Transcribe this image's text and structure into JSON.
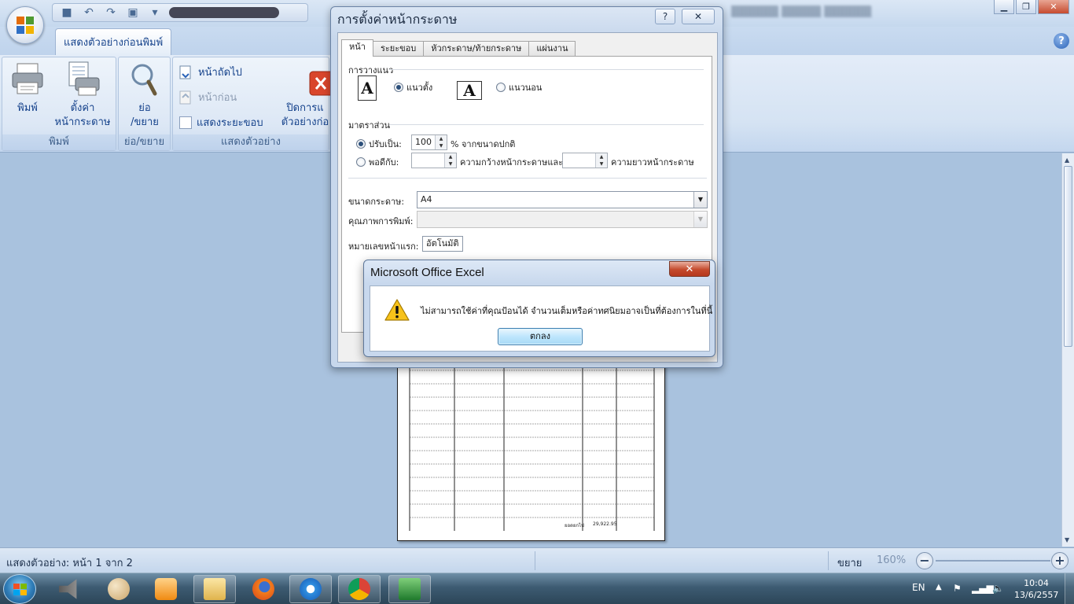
{
  "ribbon": {
    "tab_label": "แสดงตัวอย่างก่อนพิมพ์",
    "print_button": "พิมพ์",
    "page_setup_button_line1": "ตั้งค่า",
    "page_setup_button_line2": "หน้ากระดาษ",
    "zoom_button_line1": "ย่อ",
    "zoom_button_line2": "/ขยาย",
    "next_page": "หน้าถัดไป",
    "prev_page": "หน้าก่อน",
    "show_margins": "แสดงระยะขอบ",
    "close_preview_line1": "ปิดการแ",
    "close_preview_line2": "ตัวอย่างก่อ",
    "group_print": "พิมพ์",
    "group_zoom": "ย่อ/ขยาย",
    "group_preview": "แสดงตัวอย่าง",
    "help": "?"
  },
  "page_setup": {
    "title": "การตั้งค่าหน้ากระดาษ",
    "help_btn": "?",
    "close_btn": "✕",
    "tabs": [
      "หน้า",
      "ระยะขอบ",
      "หัวกระดาษ/ท้ายกระดาษ",
      "แผ่นงาน"
    ],
    "orientation_section": "การวางแนว",
    "portrait": "แนวตั้ง",
    "landscape": "แนวนอน",
    "orientation_letter": "A",
    "scaling_section": "มาตราส่วน",
    "adjust_to": "ปรับเป็น:",
    "adjust_value": "100",
    "adjust_suffix": "% จากขนาดปกติ",
    "fit_to": "พอดีกับ:",
    "fit_wide_label": "ความกว้างหน้ากระดาษและ",
    "fit_tall_label": "ความยาวหน้ากระดาษ",
    "paper_size_label": "ขนาดกระดาษ:",
    "paper_size_value": "A4",
    "print_quality_label": "คุณภาพการพิมพ์:",
    "first_page_label": "หมายเลขหน้าแรก:",
    "first_page_value": "อัตโนมัติ"
  },
  "msgbox": {
    "title": "Microsoft Office Excel",
    "close": "✕",
    "message": "ไม่สามารถใช้ค่าที่คุณป้อนได้ จำนวนเต็มหรือค่าทศนิยมอาจเป็นที่ต้องการในที่นี้",
    "ok_button": "ตกลง"
  },
  "sheet": {
    "footer_label": "ยอดยกไป",
    "footer_value": "29,922.95"
  },
  "statusbar": {
    "preview_status": "แสดงตัวอย่าง: หน้า 1 จาก 2",
    "zoom_label": "ขยาย",
    "zoom_value": "160%",
    "zoom_out": "−",
    "zoom_in": "+"
  },
  "taskbar": {
    "apps": [
      "speaker-app",
      "paint",
      "media-player",
      "explorer",
      "firefox",
      "internet-explorer",
      "chrome",
      "excel"
    ],
    "language": "EN",
    "time": "10:04",
    "date": "13/6/2557"
  },
  "colors": {
    "ribbon_text": "#15428b",
    "workspace_bg": "#a9c2de",
    "close_red": "#c64b2f"
  }
}
